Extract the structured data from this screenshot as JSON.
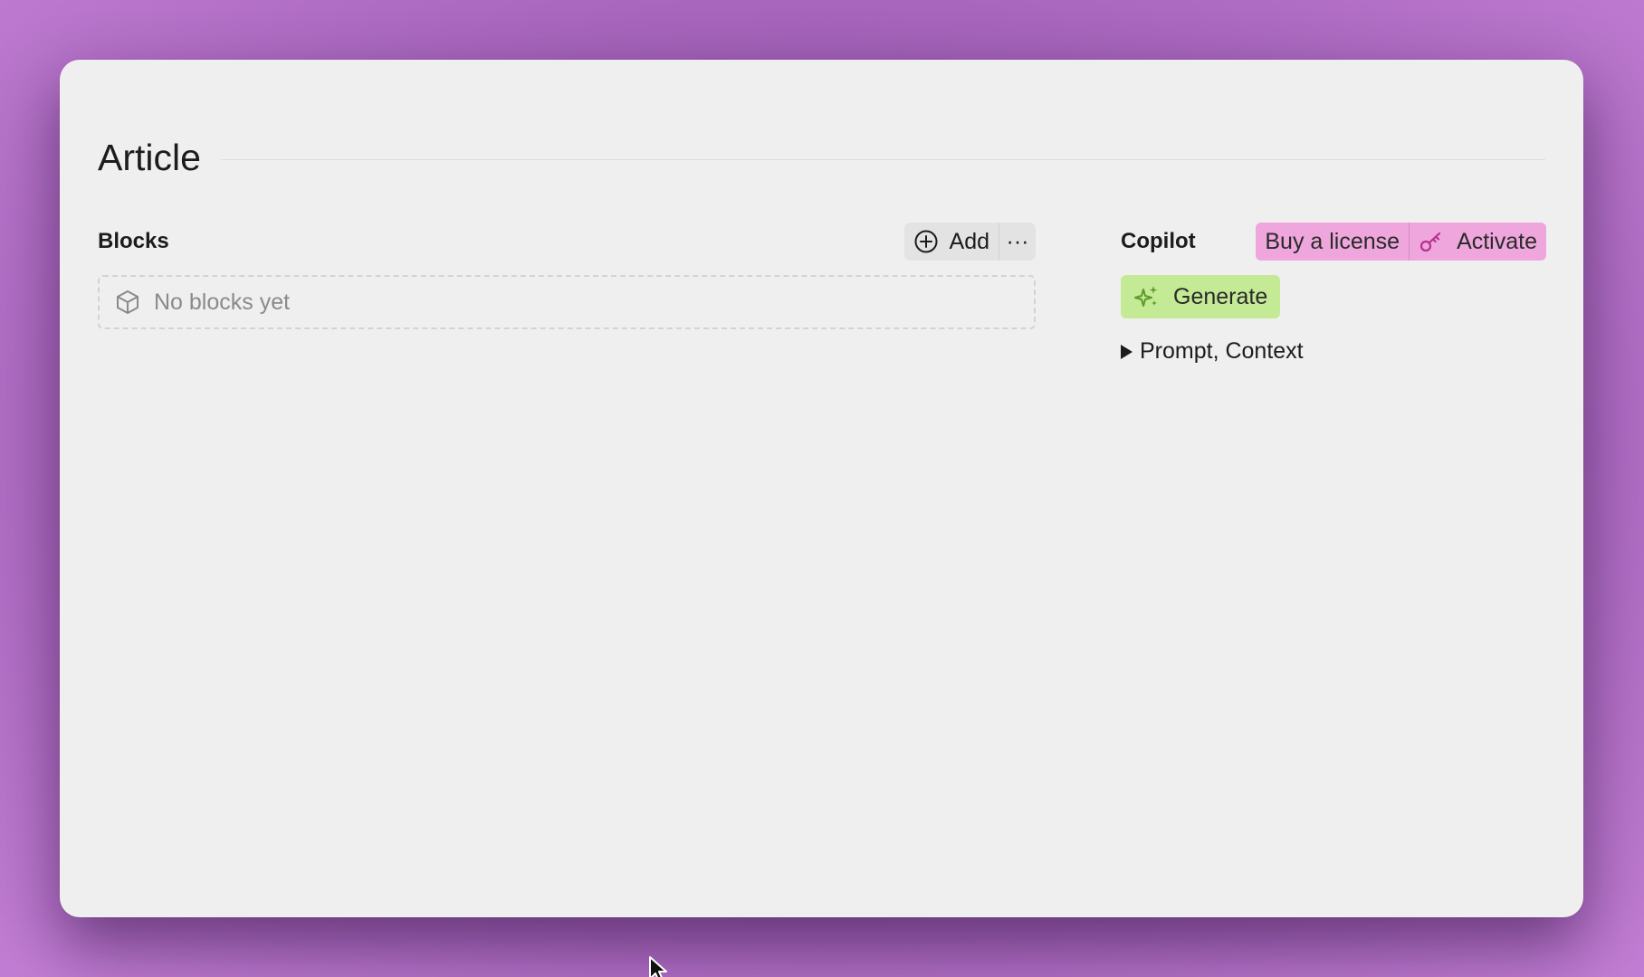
{
  "page": {
    "title": "Article"
  },
  "blocks": {
    "title": "Blocks",
    "add_label": "Add",
    "more_label": "···",
    "empty_text": "No blocks yet"
  },
  "copilot": {
    "title": "Copilot",
    "buy_label": "Buy a license",
    "activate_label": "Activate",
    "generate_label": "Generate",
    "disclosure_label": "Prompt, Context"
  },
  "icons": {
    "add": "plus-circle-icon",
    "more": "ellipsis-icon",
    "empty": "cube-icon",
    "activate": "key-icon",
    "generate": "sparkles-icon",
    "disclosure": "disclosure-triangle-icon",
    "cursor": "mouse-pointer-icon"
  },
  "colors": {
    "background": "#a05fb5",
    "window": "#efefef",
    "license_bg": "#eea6dc",
    "generate_bg": "#c4ea95",
    "sparkle": "#5c9a2a",
    "key": "#b8308e"
  }
}
